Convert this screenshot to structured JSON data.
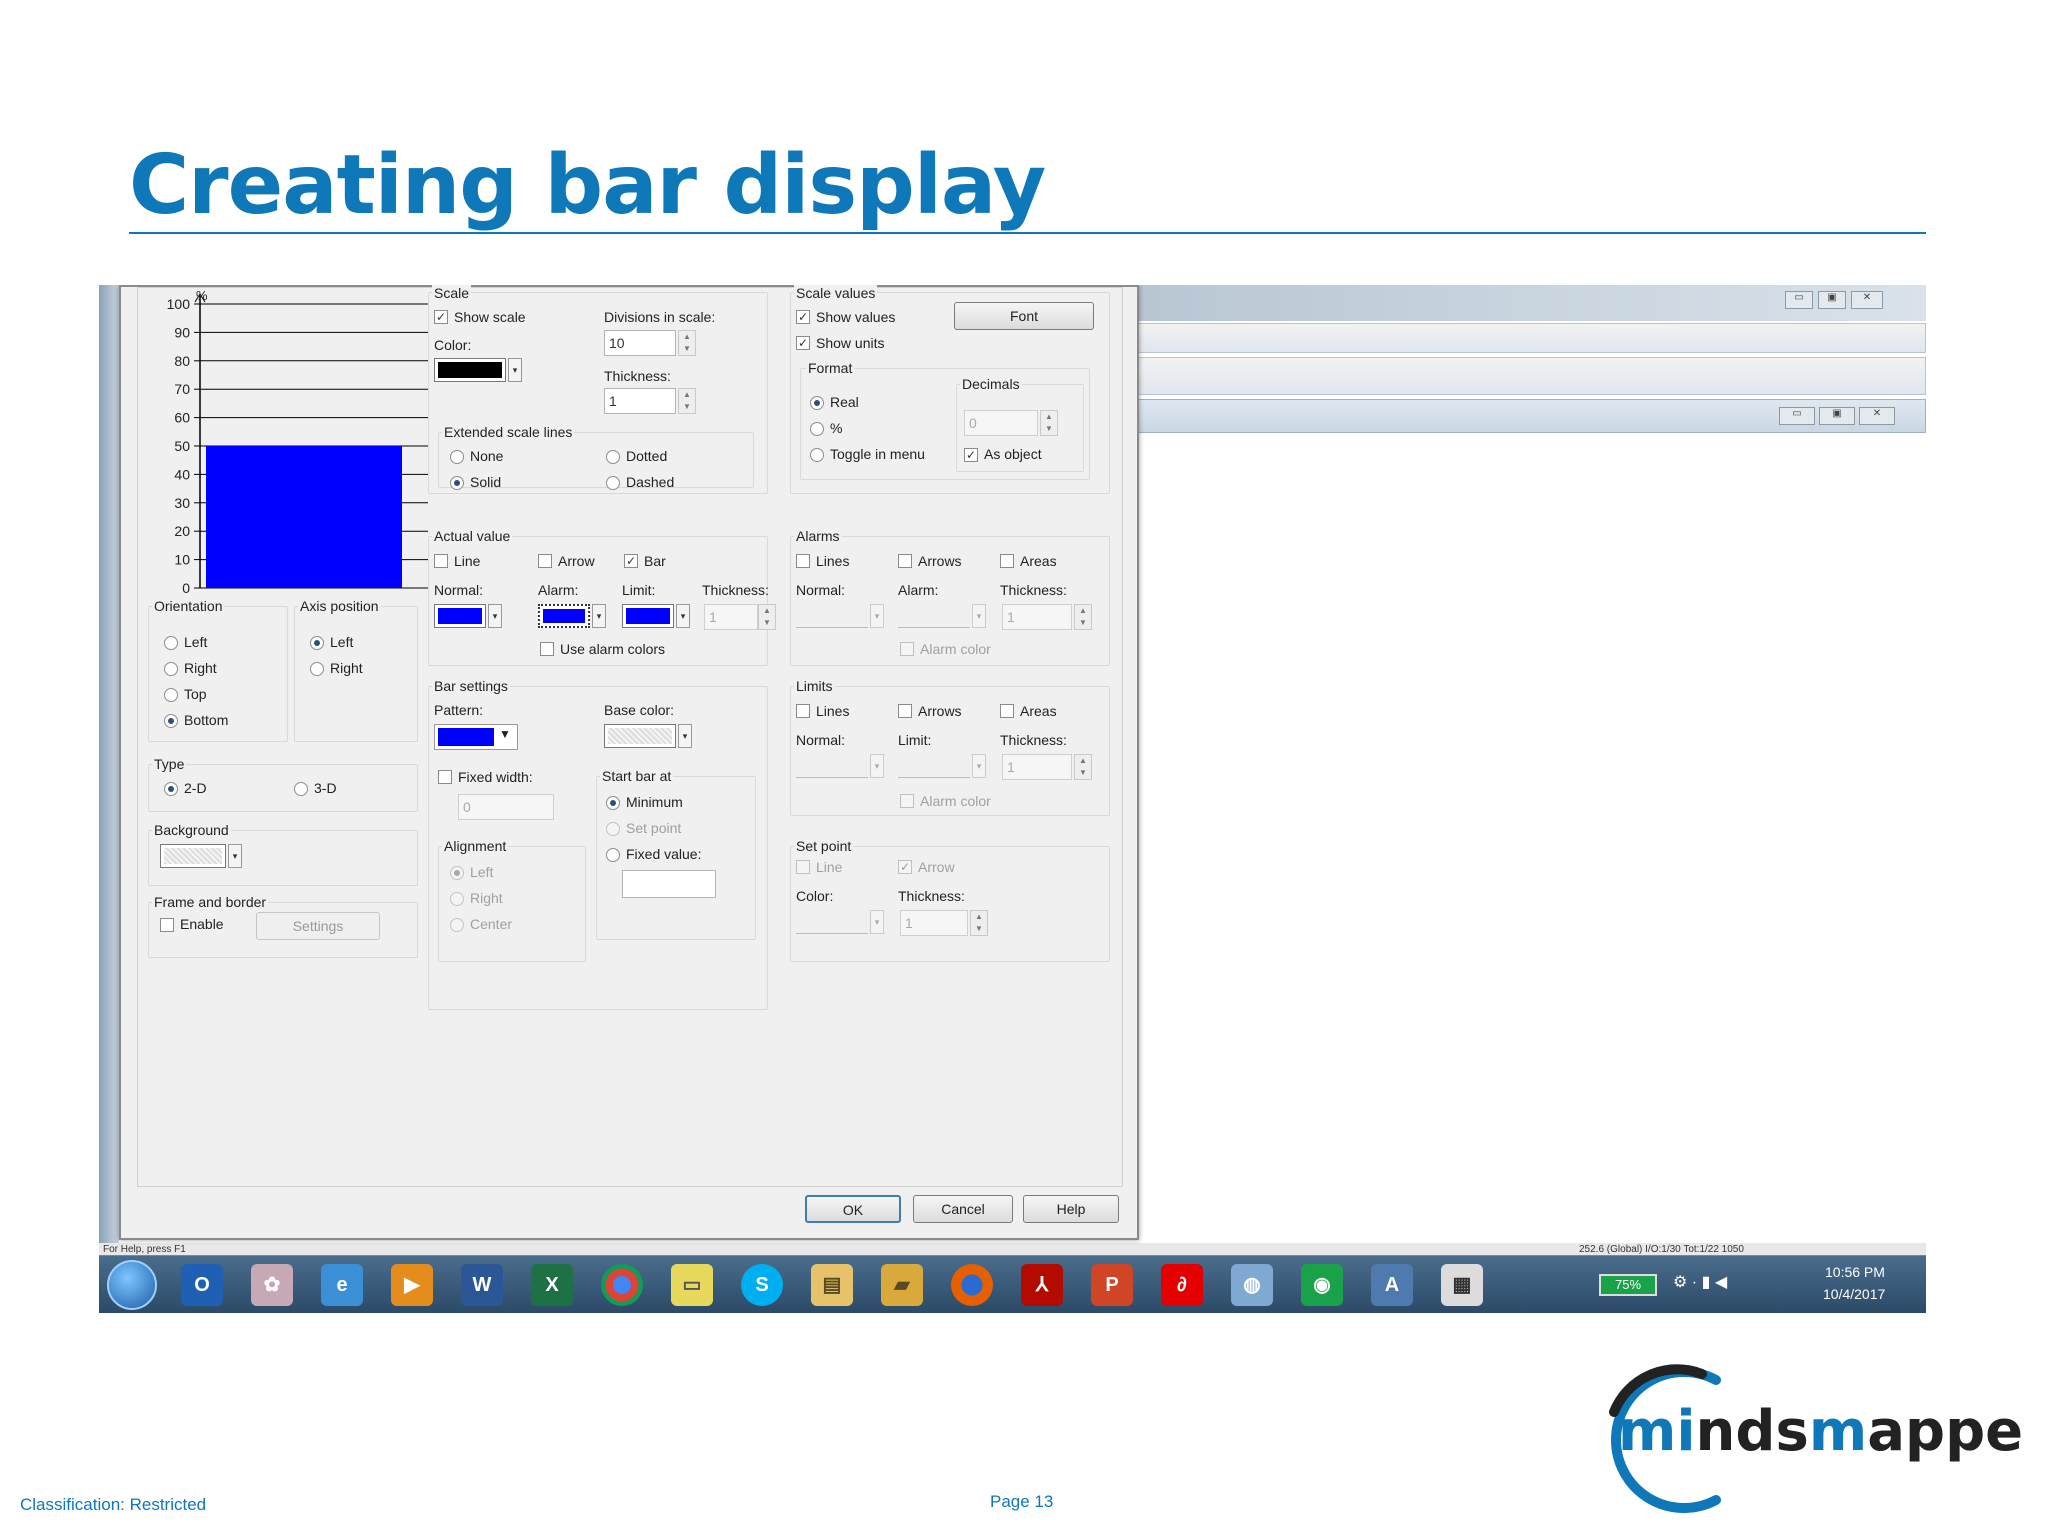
{
  "slide": {
    "title": "Creating bar display",
    "classification": "Classification: Restricted",
    "page": "Page 13",
    "logo_text": "mindsmapped"
  },
  "colors": {
    "title_blue": "#0e78b8",
    "bar_blue": "#0000ff",
    "scale_color": "#000000"
  },
  "chart_data": {
    "type": "bar",
    "y_unit": "%",
    "yticks": [
      "100",
      "90",
      "80",
      "70",
      "60",
      "50",
      "40",
      "30",
      "20",
      "10",
      "0"
    ],
    "ylim": [
      0,
      100
    ],
    "values": [
      50
    ],
    "grid": true
  },
  "dialog": {
    "orientation": {
      "label": "Orientation",
      "options": [
        "Left",
        "Right",
        "Top",
        "Bottom"
      ],
      "selected": "Bottom"
    },
    "axis_position": {
      "label": "Axis position",
      "options": [
        "Left",
        "Right"
      ],
      "selected": "Left"
    },
    "type": {
      "label": "Type",
      "options": [
        "2-D",
        "3-D"
      ],
      "selected": "2-D"
    },
    "background": {
      "label": "Background"
    },
    "frame": {
      "label": "Frame and border",
      "enable": "Enable",
      "settings": "Settings"
    },
    "scale": {
      "label": "Scale",
      "show_scale": "Show scale",
      "divisions_label": "Divisions in scale:",
      "divisions": "10",
      "color_label": "Color:",
      "thickness_label": "Thickness:",
      "thickness": "1",
      "ext_label": "Extended scale lines",
      "none": "None",
      "dotted": "Dotted",
      "solid": "Solid",
      "dashed": "Dashed"
    },
    "scale_values": {
      "label": "Scale values",
      "font": "Font",
      "show_values": "Show values",
      "show_units": "Show units",
      "format": "Format",
      "real": "Real",
      "percent": "%",
      "toggle": "Toggle in menu",
      "decimals": "Decimals",
      "decimals_value": "0",
      "as_object": "As object"
    },
    "actual": {
      "label": "Actual value",
      "line": "Line",
      "arrow": "Arrow",
      "bar": "Bar",
      "normal": "Normal:",
      "alarm": "Alarm:",
      "limit": "Limit:",
      "thickness": "Thickness:",
      "thickness_value": "1",
      "use_alarm": "Use alarm colors"
    },
    "alarms": {
      "label": "Alarms",
      "lines": "Lines",
      "arrows": "Arrows",
      "areas": "Areas",
      "normal": "Normal:",
      "alarm": "Alarm:",
      "thickness": "Thickness:",
      "thickness_value": "1",
      "alarm_color": "Alarm color"
    },
    "bar_settings": {
      "label": "Bar settings",
      "pattern": "Pattern:",
      "base_color": "Base color:",
      "fixed_width": "Fixed width:",
      "fixed_width_value": "0",
      "start_bar": "Start bar at",
      "minimum": "Minimum",
      "set_point": "Set point",
      "fixed_value": "Fixed value:",
      "alignment": "Alignment",
      "left": "Left",
      "right": "Right",
      "center": "Center"
    },
    "limits": {
      "label": "Limits",
      "lines": "Lines",
      "arrows": "Arrows",
      "areas": "Areas",
      "normal": "Normal:",
      "limit": "Limit:",
      "thickness": "Thickness:",
      "thickness_value": "1",
      "alarm_color": "Alarm color"
    },
    "setpoint": {
      "label": "Set point",
      "line": "Line",
      "arrow": "Arrow",
      "color": "Color:",
      "thickness": "Thickness:",
      "thickness_value": "1"
    },
    "buttons": {
      "ok": "OK",
      "cancel": "Cancel",
      "help": "Help"
    }
  },
  "taskbar": {
    "battery": "75%",
    "time": "10:56 PM",
    "date": "10/4/2017",
    "status_left": "For Help, press F1",
    "status_right": "252.6 (Global) I/O:1/30 Tot:1/22 1050"
  }
}
